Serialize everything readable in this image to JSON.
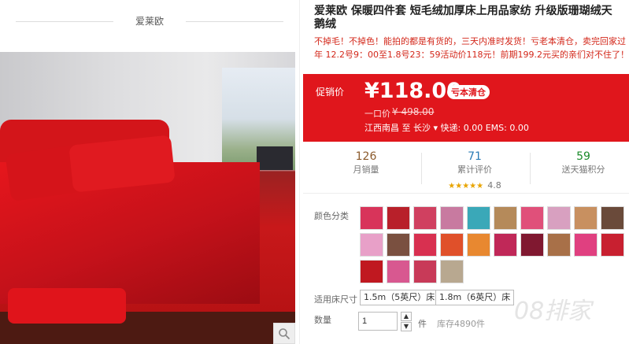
{
  "shop": {
    "name": "爱莱欧"
  },
  "product": {
    "title_line1": "爱莱欧 保暖四件套 短毛绒加厚床上用品家纺 升级版珊瑚绒天",
    "title_line2": "鹅绒",
    "promo": "不掉毛！不掉色！能拍的都是有货的，三天内准时发货！亏老本清仓，卖完回家过年 12.2号9：00至1.8号23：59活动价118元！前期199.2元买的亲们对不住了！"
  },
  "price": {
    "label": "促销价",
    "current": "¥118.00",
    "tag": "亏本清仓",
    "orig_label": "一口价",
    "orig": "¥ 498.00",
    "ship_from": "江西南昌 至",
    "dest": "长沙",
    "shipping": "快递: 0.00 EMS: 0.00"
  },
  "stats": {
    "sales_value": "126",
    "sales_label": "月销量",
    "reviews_value": "71",
    "reviews_label": "累计评价",
    "rating": "4.8",
    "stars": "★★★★★",
    "points_value": "59",
    "points_label": "送天猫积分"
  },
  "options": {
    "color_label": "颜色分类",
    "size_label": "适用床尺寸",
    "size_options": [
      "1.5m（5英尺）床",
      "1.8m（6英尺）床"
    ],
    "qty_label": "数量",
    "qty_value": "1",
    "qty_unit": "件",
    "stock": "库存4890件"
  },
  "watermark": "08排家",
  "colors": {
    "accent": "#e0161c",
    "stars": "#e8a400",
    "sales": "#8b5a2b",
    "reviews": "#2a7bb5",
    "points": "#1a8a2a"
  }
}
